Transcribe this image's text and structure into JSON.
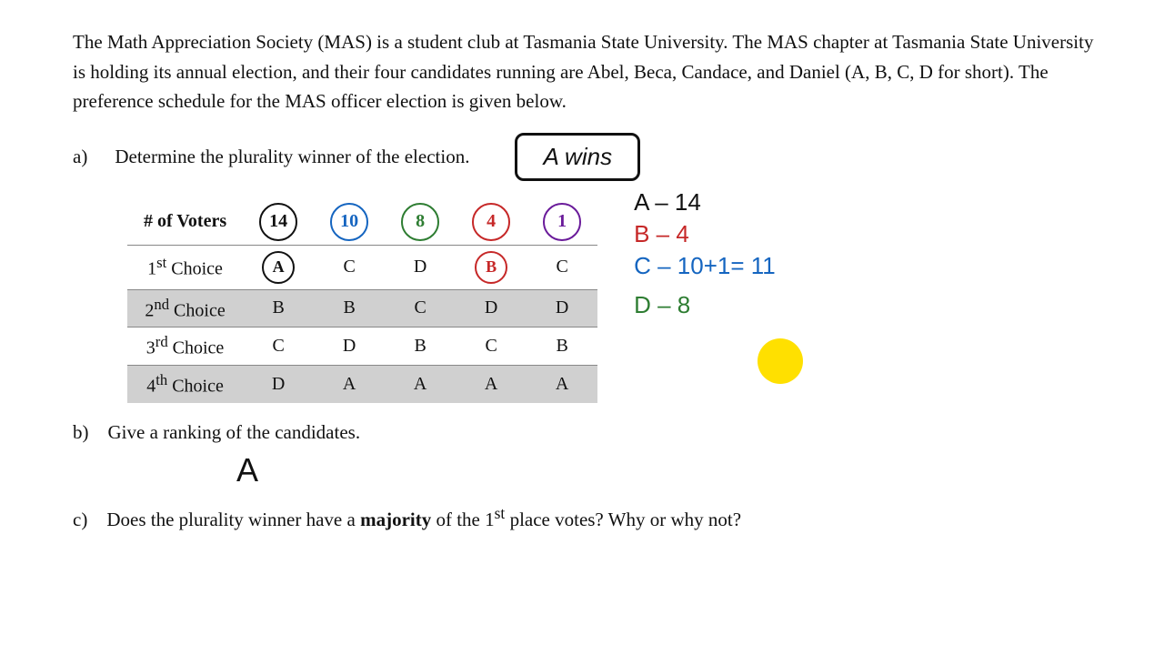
{
  "intro": {
    "text": "The Math Appreciation Society (MAS) is a student club at Tasmania State University.  The MAS chapter at Tasmania State University is holding its annual election, and their four candidates running are Abel, Beca, Candace, and Daniel (A, B, C, D for short).  The preference schedule for the MAS officer election is given below."
  },
  "question_a": {
    "label": "a)",
    "text": "Determine the plurality winner of the election.",
    "answer": "A wins"
  },
  "table": {
    "header": {
      "voters_label": "# of Voters",
      "columns": [
        "14",
        "10",
        "8",
        "4",
        "1"
      ]
    },
    "rows": [
      {
        "label": "1st Choice",
        "superscript": "st",
        "values": [
          "A",
          "C",
          "D",
          "B",
          "C"
        ],
        "shaded": false
      },
      {
        "label": "2nd Choice",
        "superscript": "nd",
        "values": [
          "B",
          "B",
          "C",
          "D",
          "D"
        ],
        "shaded": true
      },
      {
        "label": "3rd Choice",
        "superscript": "rd",
        "values": [
          "C",
          "D",
          "B",
          "C",
          "B"
        ],
        "shaded": false
      },
      {
        "label": "4th Choice",
        "superscript": "th",
        "values": [
          "D",
          "A",
          "A",
          "A",
          "A"
        ],
        "shaded": true
      }
    ]
  },
  "results": {
    "a_line": "A – 14",
    "b_line": "B – 4",
    "c_line": "C – 10+1= 11",
    "d_line": "D – 8"
  },
  "question_b": {
    "label": "b)",
    "text": "Give a ranking of the candidates.",
    "answer": "A"
  },
  "question_c": {
    "label": "c)",
    "text_before": "Does the plurality winner have a ",
    "bold_text": "majority",
    "text_after": " of the 1",
    "superscript": "st",
    "text_end": " place votes?  Why or why not?"
  }
}
